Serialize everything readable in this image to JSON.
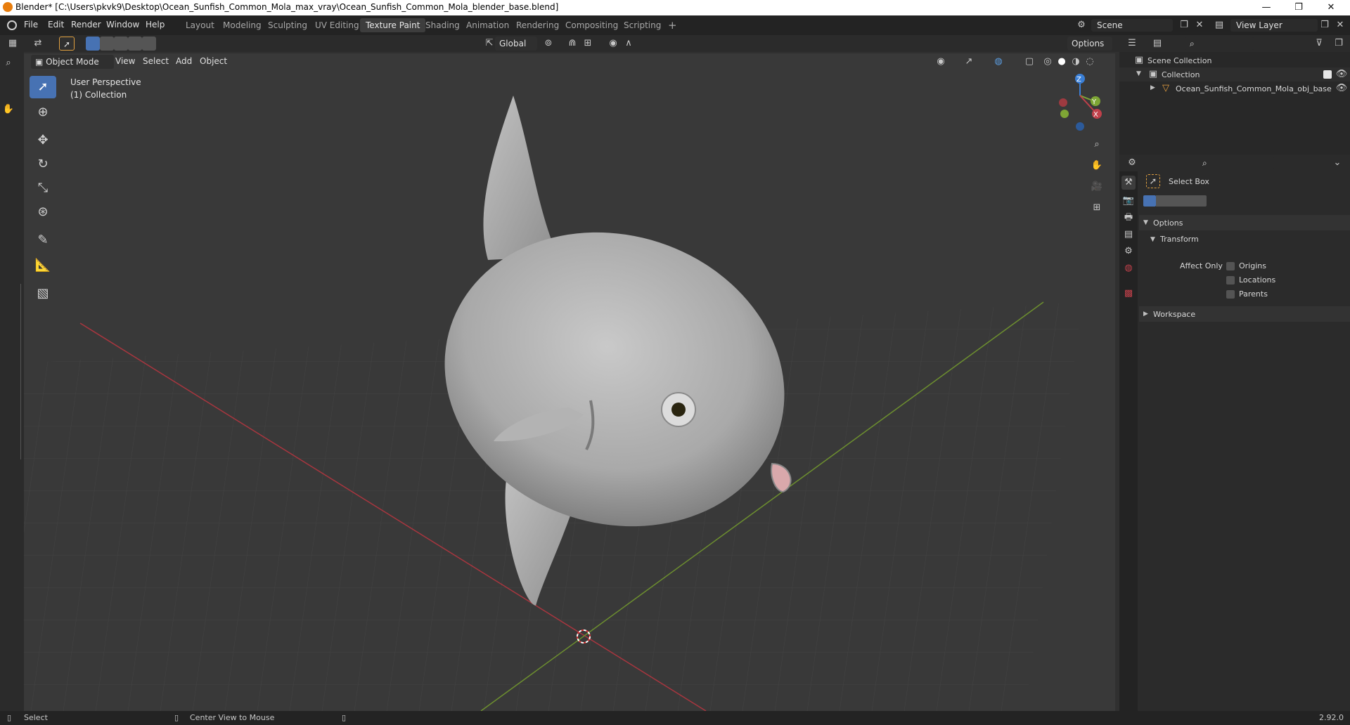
{
  "window": {
    "title": "Blender* [C:\\Users\\pkvk9\\Desktop\\Ocean_Sunfish_Common_Mola_max_vray\\Ocean_Sunfish_Common_Mola_blender_base.blend]",
    "min_glyph": "—",
    "max_glyph": "❐",
    "close_glyph": "✕"
  },
  "menu": [
    "File",
    "Edit",
    "Render",
    "Window",
    "Help"
  ],
  "workspaces": [
    {
      "label": "Layout",
      "active": false
    },
    {
      "label": "Modeling",
      "active": false
    },
    {
      "label": "Sculpting",
      "active": false
    },
    {
      "label": "UV Editing",
      "active": false
    },
    {
      "label": "Texture Paint",
      "active": true
    },
    {
      "label": "Shading",
      "active": false
    },
    {
      "label": "Animation",
      "active": false
    },
    {
      "label": "Rendering",
      "active": false
    },
    {
      "label": "Compositing",
      "active": false
    },
    {
      "label": "Scripting",
      "active": false
    }
  ],
  "add_workspace_glyph": "+",
  "scene_field": "Scene",
  "view_layer_field": "View Layer",
  "viewport_header": {
    "transform_orientation": "Global",
    "options_label": "Options",
    "mode": "Object Mode",
    "menus": [
      "View",
      "Select",
      "Add",
      "Object"
    ]
  },
  "viewport_overlay": {
    "perspective": "User Perspective",
    "collection": "(1) Collection"
  },
  "gizmo": {
    "z": "Z",
    "y": "Y",
    "x": "X"
  },
  "outliner": {
    "scene_collection": "Scene Collection",
    "collection": "Collection",
    "object": "Ocean_Sunfish_Common_Mola_obj_base"
  },
  "properties": {
    "active_tool": "Select Box",
    "options_panel": "Options",
    "transform_subpanel": "Transform",
    "affect_only_label": "Affect Only",
    "affect_only_options": [
      "Origins",
      "Locations",
      "Parents"
    ],
    "workspace_panel": "Workspace"
  },
  "statusbar": {
    "select": "Select",
    "center_view": "Center View to Mouse",
    "version": "2.92.0"
  },
  "colors": {
    "accent": "#4772b3",
    "x_axis": "#c0404a",
    "y_axis": "#7ea635",
    "z_axis": "#3a7fd6"
  }
}
